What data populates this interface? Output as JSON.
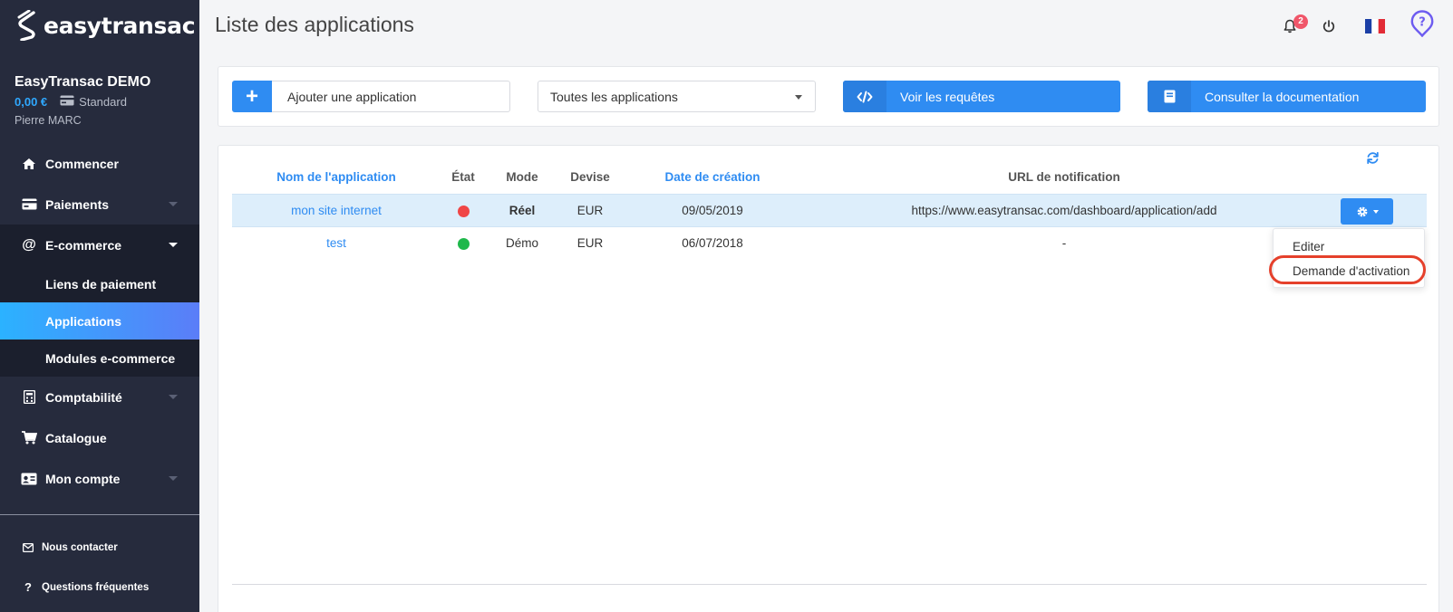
{
  "brand": {
    "name": "easytransac"
  },
  "account": {
    "name": "EasyTransac DEMO",
    "balance": "0,00 €",
    "plan": "Standard",
    "user": "Pierre MARC"
  },
  "nav": {
    "commencer": "Commencer",
    "paiements": "Paiements",
    "ecommerce": "E-commerce",
    "sub": [
      "Liens de paiement",
      "Applications",
      "Modules e-commerce"
    ],
    "comptabilite": "Comptabilité",
    "catalogue": "Catalogue",
    "compte": "Mon compte"
  },
  "footer": {
    "contact": "Nous contacter",
    "faq": "Questions fréquentes"
  },
  "header": {
    "title": "Liste des applications",
    "notification_count": "2"
  },
  "toolbar": {
    "add_label": "Ajouter une application",
    "filter_value": "Toutes les applications",
    "requests_label": "Voir les requêtes",
    "docs_label": "Consulter la documentation"
  },
  "table": {
    "columns": [
      "Nom de l'application",
      "État",
      "Mode",
      "Devise",
      "Date de création",
      "URL de notification"
    ],
    "rows": [
      {
        "name": "mon site internet",
        "state": "red",
        "mode": "Réel",
        "currency": "EUR",
        "date": "09/05/2019",
        "url": "https://www.easytransac.com/dashboard/application/add"
      },
      {
        "name": "test",
        "state": "green",
        "mode": "Démo",
        "currency": "EUR",
        "date": "06/07/2018",
        "url": "-"
      }
    ]
  },
  "menu": {
    "edit": "Editer",
    "activation": "Demande d'activation"
  },
  "colors": {
    "accent": "#2f8cf2",
    "sidebar": "#262b3d",
    "status_red": "#f04646",
    "status_green": "#1fb84b",
    "highlight": "#e5402b"
  }
}
